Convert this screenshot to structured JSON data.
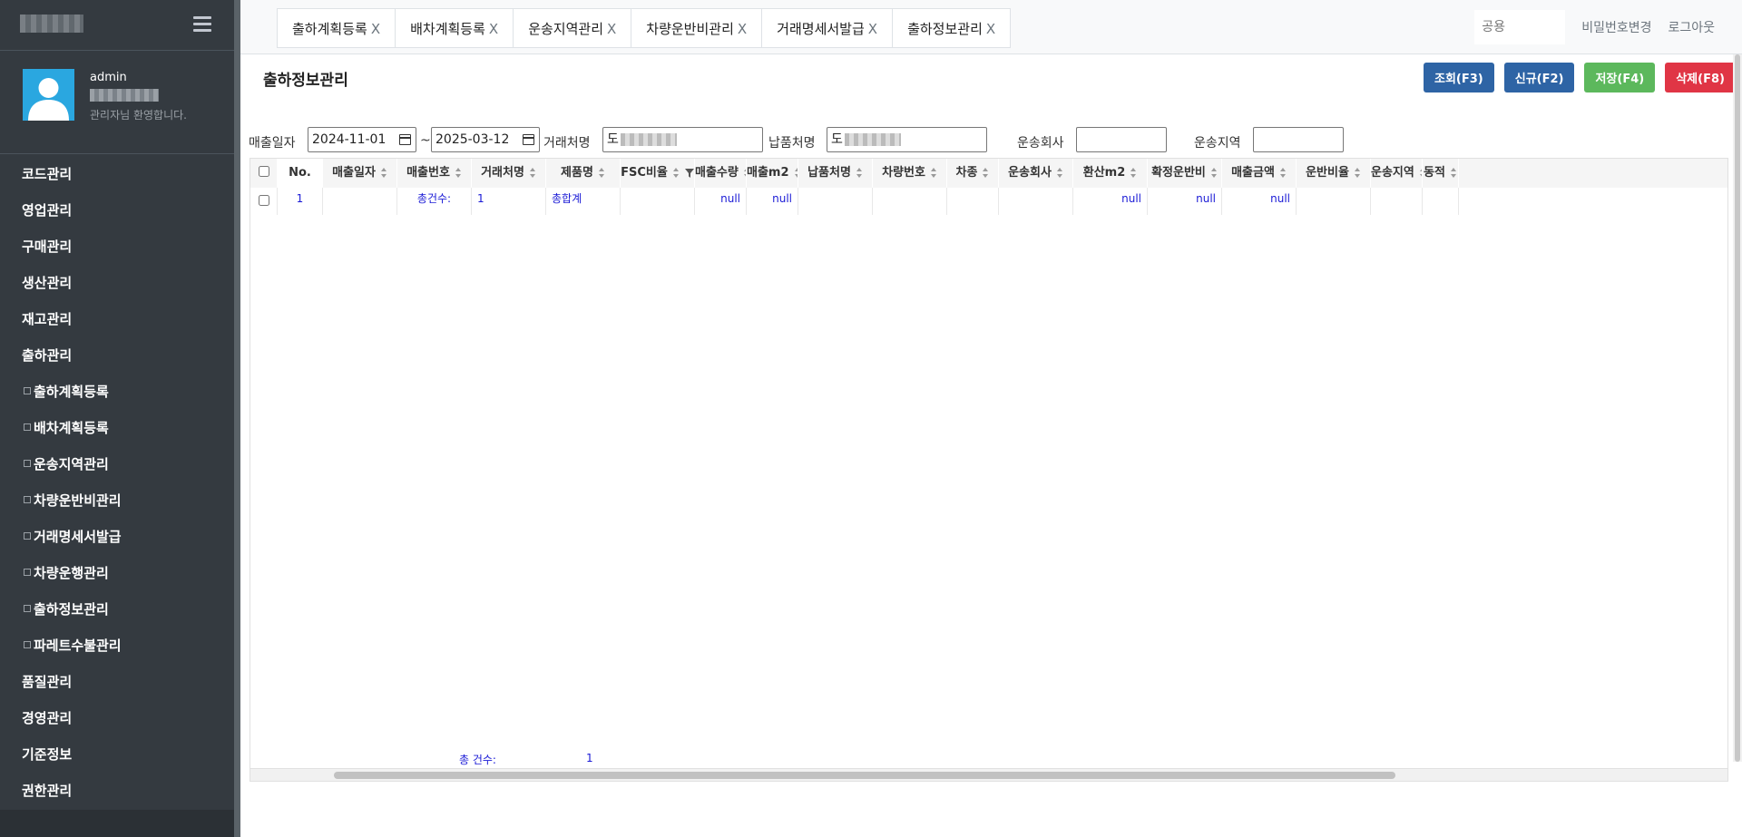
{
  "sidebar": {
    "user": {
      "name": "admin",
      "welcome": "관리자님 환영합니다."
    },
    "items": [
      {
        "label": "코드관리",
        "sub": false
      },
      {
        "label": "영업관리",
        "sub": false
      },
      {
        "label": "구매관리",
        "sub": false
      },
      {
        "label": "생산관리",
        "sub": false
      },
      {
        "label": "재고관리",
        "sub": false
      },
      {
        "label": "출하관리",
        "sub": false
      },
      {
        "label": "출하계획등록",
        "sub": true
      },
      {
        "label": "배차계획등록",
        "sub": true
      },
      {
        "label": "운송지역관리",
        "sub": true
      },
      {
        "label": "차량운반비관리",
        "sub": true
      },
      {
        "label": "거래명세서발급",
        "sub": true
      },
      {
        "label": "차량운행관리",
        "sub": true
      },
      {
        "label": "출하정보관리",
        "sub": true
      },
      {
        "label": "파레트수불관리",
        "sub": true
      },
      {
        "label": "품질관리",
        "sub": false
      },
      {
        "label": "경영관리",
        "sub": false
      },
      {
        "label": "기준정보",
        "sub": false
      },
      {
        "label": "권한관리",
        "sub": false
      }
    ]
  },
  "tabs": [
    {
      "label": "출하계획등록",
      "close": "X"
    },
    {
      "label": "배차계획등록",
      "close": "X"
    },
    {
      "label": "운송지역관리",
      "close": "X"
    },
    {
      "label": "차량운반비관리",
      "close": "X"
    },
    {
      "label": "거래명세서발급",
      "close": "X"
    },
    {
      "label": "출하정보관리",
      "close": "X"
    }
  ],
  "topbar": {
    "common_placeholder": "공용",
    "change_password": "비밀번호변경",
    "logout": "로그아웃"
  },
  "page": {
    "title": "출하정보관리"
  },
  "actions": {
    "search": "조회(F3)",
    "new": "신규(F2)",
    "save": "저장(F4)",
    "delete": "삭제(F8)"
  },
  "filters": {
    "sales_date_label": "매출일자",
    "date_from": "2024-11-01",
    "tilde": "~",
    "date_to": "2025-03-12",
    "customer_label": "거래처명",
    "customer_value": "도",
    "delivery_label": "납품처명",
    "delivery_value": "도",
    "transport_company_label": "운송회사",
    "transport_region_label": "운송지역"
  },
  "grid": {
    "columns": [
      "No.",
      "매출일자",
      "매출번호",
      "거래처명",
      "제품명",
      "FSC비율",
      "매출수량",
      "매출m2",
      "납품처명",
      "차량번호",
      "차종",
      "운송회사",
      "환산m2",
      "확정운반비",
      "매출금액",
      "운반비율",
      "운송지역",
      "동적"
    ],
    "row": {
      "no": "1",
      "sales_date": "",
      "sales_no": "총건수:",
      "customer": "1",
      "product": "총합계",
      "fsc": "",
      "qty": "null",
      "m2": "null",
      "delivery": "",
      "vehicle_no": "",
      "vehicle_type": "",
      "transport_company": "",
      "conv_m2": "null",
      "confirmed_fee": "null",
      "amount": "null",
      "fee_ratio": "",
      "region": "",
      "dynamic": ""
    },
    "footer": {
      "label": "총 건수:",
      "count": "1"
    }
  }
}
